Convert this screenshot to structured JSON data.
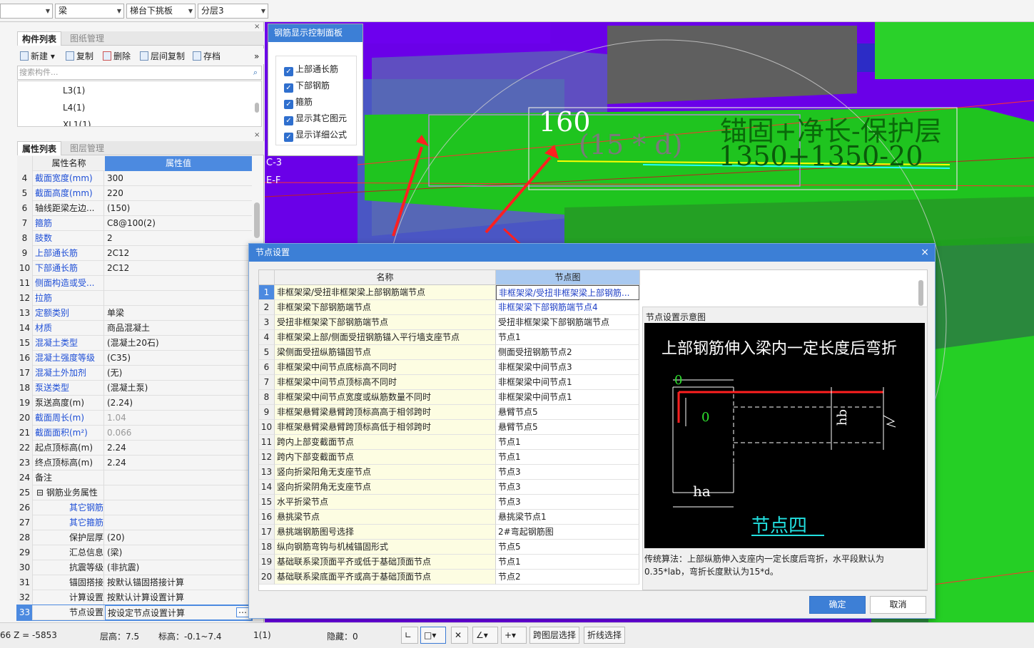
{
  "toolbar": {
    "combo1": "",
    "combo2": "梁",
    "combo3": "梯台下挑板",
    "combo4": "分层3"
  },
  "component_panel": {
    "tabs": [
      "构件列表",
      "图纸管理"
    ],
    "actions": [
      "新建",
      "复制",
      "删除",
      "层间复制",
      "存档"
    ],
    "search_placeholder": "搜索构件...",
    "items": [
      "L3(1)",
      "L4(1)",
      "XL1(1)"
    ]
  },
  "property_panel": {
    "tabs": [
      "属性列表",
      "图层管理"
    ],
    "col_name": "属性名称",
    "col_value": "属性值",
    "rows": [
      {
        "n": "4",
        "name": "截面宽度(mm)",
        "value": "300",
        "blue": true
      },
      {
        "n": "5",
        "name": "截面高度(mm)",
        "value": "220",
        "blue": true
      },
      {
        "n": "6",
        "name": "轴线距梁左边...",
        "value": "(150)",
        "blue": false
      },
      {
        "n": "7",
        "name": "箍筋",
        "value": "C8@100(2)",
        "blue": true
      },
      {
        "n": "8",
        "name": "肢数",
        "value": "2",
        "blue": true
      },
      {
        "n": "9",
        "name": "上部通长筋",
        "value": "2C12",
        "blue": true
      },
      {
        "n": "10",
        "name": "下部通长筋",
        "value": "2C12",
        "blue": true
      },
      {
        "n": "11",
        "name": "侧面构造或受...",
        "value": "",
        "blue": true
      },
      {
        "n": "12",
        "name": "拉筋",
        "value": "",
        "blue": true
      },
      {
        "n": "13",
        "name": "定额类别",
        "value": "单梁",
        "blue": true
      },
      {
        "n": "14",
        "name": "材质",
        "value": "商品混凝土",
        "blue": true
      },
      {
        "n": "15",
        "name": "混凝土类型",
        "value": "(混凝土20石)",
        "blue": true
      },
      {
        "n": "16",
        "name": "混凝土强度等级",
        "value": "(C35)",
        "blue": true
      },
      {
        "n": "17",
        "name": "混凝土外加剂",
        "value": "(无)",
        "blue": true
      },
      {
        "n": "18",
        "name": "泵送类型",
        "value": "(混凝土泵)",
        "blue": true
      },
      {
        "n": "19",
        "name": "泵送高度(m)",
        "value": "(2.24)",
        "blue": false
      },
      {
        "n": "20",
        "name": "截面周长(m)",
        "value": "1.04",
        "blue": true,
        "gray": true
      },
      {
        "n": "21",
        "name": "截面面积(m²)",
        "value": "0.066",
        "blue": true,
        "gray": true
      },
      {
        "n": "22",
        "name": "起点顶标高(m)",
        "value": "2.24",
        "blue": false
      },
      {
        "n": "23",
        "name": "终点顶标高(m)",
        "value": "2.24",
        "blue": false
      },
      {
        "n": "24",
        "name": "备注",
        "value": "",
        "blue": false
      },
      {
        "n": "25",
        "name": "钢筋业务属性",
        "value": "",
        "blue": false,
        "group": true
      },
      {
        "n": "26",
        "name": "其它钢筋",
        "value": "",
        "blue": true,
        "indent": true
      },
      {
        "n": "27",
        "name": "其它箍筋",
        "value": "",
        "blue": true,
        "indent": true
      },
      {
        "n": "28",
        "name": "保护层厚...",
        "value": "(20)",
        "blue": false,
        "indent": true
      },
      {
        "n": "29",
        "name": "汇总信息",
        "value": "(梁)",
        "blue": false,
        "indent": true
      },
      {
        "n": "30",
        "name": "抗震等级",
        "value": "(非抗震)",
        "blue": false,
        "indent": true
      },
      {
        "n": "31",
        "name": "锚固搭接",
        "value": "按默认锚固搭接计算",
        "blue": false,
        "indent": true
      },
      {
        "n": "32",
        "name": "计算设置",
        "value": "按默认计算设置计算",
        "blue": false,
        "indent": true
      },
      {
        "n": "33",
        "name": "节点设置",
        "value": "按设定节点设置计算",
        "blue": false,
        "indent": true,
        "selected": true
      }
    ]
  },
  "rebar_panel": {
    "title": "钢筋显示控制面板",
    "options": [
      "上部通长筋",
      "下部钢筋",
      "箍筋",
      "显示其它图元",
      "显示详细公式"
    ]
  },
  "view3d": {
    "label_160": "160",
    "label_formula": "(15 * d)",
    "label_anchor": "锚固+净长-保护层",
    "label_sum": "1350+1350-20",
    "axis_labels": [
      "C-3",
      "E-F"
    ]
  },
  "dialog": {
    "title": "节点设置",
    "close": "×",
    "col_name": "名称",
    "col_node": "节点图",
    "rows": [
      {
        "n": "1",
        "name": "非框架梁/受扭非框架梁上部钢筋端节点",
        "node": "非框架梁/受扭非框架梁上部钢筋...",
        "link": true
      },
      {
        "n": "2",
        "name": "非框架梁下部钢筋端节点",
        "node": "非框架梁下部钢筋端节点4",
        "link": true
      },
      {
        "n": "3",
        "name": "受扭非框架梁下部钢筋端节点",
        "node": "受扭非框架梁下部钢筋端节点",
        "link": false
      },
      {
        "n": "4",
        "name": "非框架梁上部/侧面受扭钢筋锚入平行墙支座节点",
        "node": "节点1",
        "link": false
      },
      {
        "n": "5",
        "name": "梁侧面受扭纵筋锚固节点",
        "node": "侧面受扭钢筋节点2",
        "link": false
      },
      {
        "n": "6",
        "name": "非框架梁中间节点底标高不同时",
        "node": "非框架梁中间节点3",
        "link": false
      },
      {
        "n": "7",
        "name": "非框架梁中间节点顶标高不同时",
        "node": "非框架梁中间节点1",
        "link": false
      },
      {
        "n": "8",
        "name": "非框架梁中间节点宽度或纵筋数量不同时",
        "node": "非框架梁中间节点1",
        "link": false
      },
      {
        "n": "9",
        "name": "非框架悬臂梁悬臂跨顶标高高于相邻跨时",
        "node": "悬臂节点5",
        "link": false
      },
      {
        "n": "10",
        "name": "非框架悬臂梁悬臂跨顶标高低于相邻跨时",
        "node": "悬臂节点5",
        "link": false
      },
      {
        "n": "11",
        "name": "跨内上部变截面节点",
        "node": "节点1",
        "link": false
      },
      {
        "n": "12",
        "name": "跨内下部变截面节点",
        "node": "节点1",
        "link": false
      },
      {
        "n": "13",
        "name": "竖向折梁阳角无支座节点",
        "node": "节点3",
        "link": false
      },
      {
        "n": "14",
        "name": "竖向折梁阴角无支座节点",
        "node": "节点3",
        "link": false
      },
      {
        "n": "15",
        "name": "水平折梁节点",
        "node": "节点3",
        "link": false
      },
      {
        "n": "16",
        "name": "悬挑梁节点",
        "node": "悬挑梁节点1",
        "link": false
      },
      {
        "n": "17",
        "name": "悬挑端钢筋图号选择",
        "node": "2#弯起钢筋图",
        "link": false
      },
      {
        "n": "18",
        "name": "纵向钢筋弯钩与机械锚固形式",
        "node": "节点5",
        "link": false
      },
      {
        "n": "19",
        "name": "基础联系梁顶面平齐或低于基础顶面节点",
        "node": "节点1",
        "link": false
      },
      {
        "n": "20",
        "name": "基础联系梁底面平齐或高于基础顶面节点",
        "node": "节点2",
        "link": false
      }
    ],
    "preview_title": "节点设置示意图",
    "preview_heading": "上部钢筋伸入梁内一定长度后弯折",
    "preview_node": "节点四",
    "preview_labels": {
      "zero_top": "0",
      "zero_mid": "0",
      "hb": "hb",
      "ha": "ha"
    },
    "description": "传统算法：上部纵筋伸入支座内一定长度后弯折，水平段默认为0.35*lab，弯折长度默认为15*d。",
    "ok": "确定",
    "cancel": "取消"
  },
  "statusbar": {
    "coord": "66 Z = -5853",
    "floor_height": "层高：7.5",
    "elevation": "标高：-0.1~7.4",
    "count": "1(1)",
    "hidden": "隐藏：0",
    "btn_cross_layer": "跨图层选择",
    "btn_polyline": "折线选择"
  }
}
